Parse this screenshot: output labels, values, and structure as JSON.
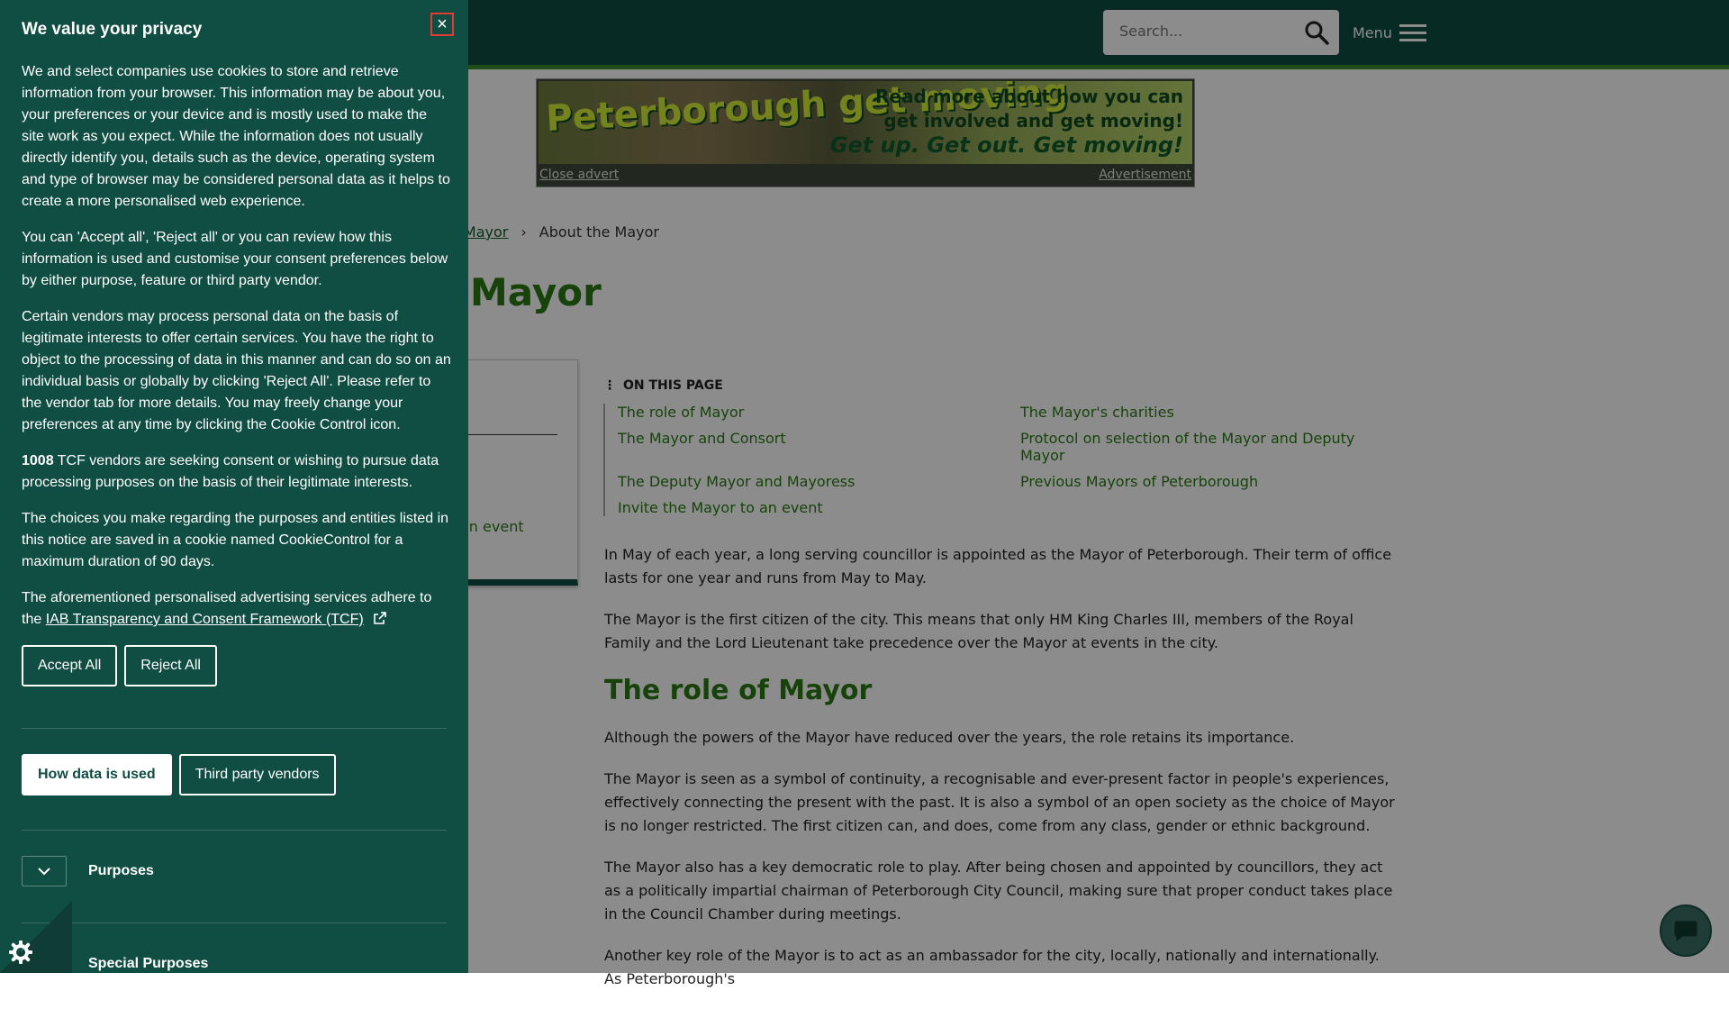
{
  "header": {
    "search_placeholder": "Search...",
    "menu_label": "Menu"
  },
  "advert": {
    "logo_text": "Peterborough get moving",
    "line1": "Read more about how you can",
    "line2": "get involved and get moving!",
    "line3": "Get up. Get out. Get moving!",
    "close_label": "Close advert",
    "advertisement_label": "Advertisement"
  },
  "breadcrumb": {
    "link": "e Mayor",
    "current": "About the Mayor"
  },
  "page": {
    "title": "Mayor"
  },
  "side_card": {
    "item": "an event"
  },
  "toc": {
    "heading": "ON THIS PAGE",
    "links": [
      "The role of Mayor",
      "The Mayor's charities",
      "The Mayor and Consort",
      "Protocol on selection of the Mayor and Deputy Mayor",
      "The Deputy Mayor and Mayoress",
      "Previous Mayors of Peterborough",
      "Invite the Mayor to an event"
    ]
  },
  "content": {
    "p1": "In May of each year, a long serving councillor is appointed as the Mayor of Peterborough. Their term of office lasts for one year and runs from May to May.",
    "p2": "The Mayor is the first citizen of the city. This means that only HM King Charles III, members of the Royal Family and the Lord Lieutenant take precedence over the Mayor at events in the city.",
    "h2": "The role of Mayor",
    "p3": "Although the powers of the Mayor have reduced over the years, the role retains its importance.",
    "p4": "The Mayor is seen as a symbol of continuity, a recognisable and ever-present factor in people's experiences, effectively connecting the present with the past. It is also a symbol of an open society as the choice of Mayor is no longer restricted. The first citizen can, and does, come from any class, gender or ethnic background.",
    "p5": "The Mayor also has a key democratic role to play. After being chosen and appointed by councillors, they act as a politically impartial chairman of Peterborough City Council, making sure that proper conduct takes place in the Council Chamber during meetings.",
    "p6": "Another key role of the Mayor is to act as an ambassador for the city, locally, nationally and internationally. As Peterborough's"
  },
  "privacy": {
    "title": "We value your privacy",
    "close_label": "×",
    "p1": "We and select companies use cookies to store and retrieve information from your browser. This information may be about you, your preferences or your device and is mostly used to make the site work as you expect. While the information does not usually directly identify you, details such as the device, operating system and type of browser may be considered personal data as it helps to create a more personalised web experience.",
    "p2": "You can 'Accept all', 'Reject all' or you can review how this information is used and customise your consent preferences below by either purpose, feature or third party vendor.",
    "p3": "Certain vendors may process personal data on the basis of legitimate interests to offer certain services. You have the right to object to the processing of data in this manner and can do so on an individual basis or globally by clicking 'Reject All'. Please refer to the vendor tab for more details. You may freely change your preferences at any time by clicking the Cookie Control icon.",
    "vendor_count": "1008",
    "p4_rest": " TCF vendors are seeking consent or wishing to pursue data processing purposes on the basis of their legitimate interests.",
    "p5": "The choices you make regarding the purposes and entities listed in this notice are saved in a cookie named CookieControl for a maximum duration of 90 days.",
    "p6_prefix": "The aforementioned personalised advertising services adhere to the ",
    "p6_link": "IAB Transparency and Consent Framework (TCF)",
    "accept_all": "Accept All",
    "reject_all": "Reject All",
    "tab_data": "How data is used",
    "tab_vendors": "Third party vendors",
    "purposes": "Purposes",
    "special_purposes": "Special Purposes"
  }
}
